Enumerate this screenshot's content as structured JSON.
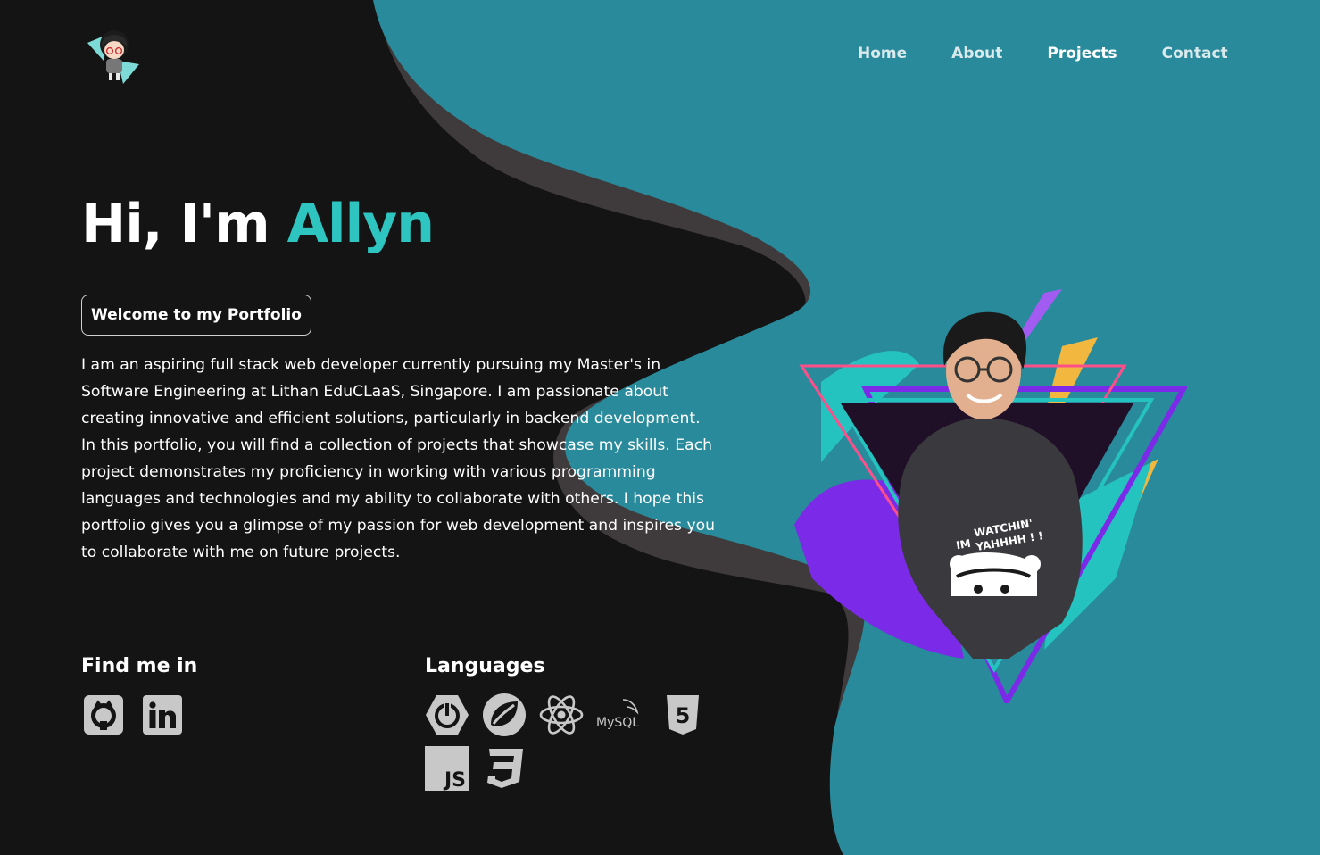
{
  "nav": {
    "items": [
      {
        "label": "Home"
      },
      {
        "label": "About"
      },
      {
        "label": "Projects",
        "active": true
      },
      {
        "label": "Contact"
      }
    ]
  },
  "hero": {
    "greeting": "Hi, I'm",
    "name": "Allyn",
    "welcome_label": "Welcome to my Portfolio",
    "bio_p1": "I am an aspiring full stack web developer currently pursuing my Master's in Software Engineering at Lithan EduCLaaS, Singapore. I am passionate about creating innovative and efficient solutions, particularly in backend development.",
    "bio_p2": "In this portfolio, you will find a collection of projects that showcase my skills. Each project demonstrates my proficiency in working with various programming languages and technologies and my ability to collaborate with others. I hope this portfolio gives you a glimpse of my passion for web development and inspires you to collaborate with me on future projects."
  },
  "find_me": {
    "title": "Find me in",
    "items": [
      "github-icon",
      "linkedin-icon"
    ]
  },
  "languages": {
    "title": "Languages",
    "items": [
      "spring-boot-icon",
      "spring-icon",
      "react-icon",
      "mysql-icon",
      "html5-icon",
      "javascript-icon",
      "css3-icon"
    ],
    "mysql_text": "MySQL",
    "js_text": "JS",
    "html_text": "5"
  },
  "portrait": {
    "shirt_line1": "WATCHIN'",
    "shirt_line2": "YAHHHH ! !",
    "shirt_prefix": "IM"
  },
  "colors": {
    "background": "#141414",
    "accent_teal": "#2ec4c0",
    "blob_teal": "#288a9b",
    "blob_shadow": "#3f3b3c",
    "icon_grey": "#c8c8c8"
  }
}
